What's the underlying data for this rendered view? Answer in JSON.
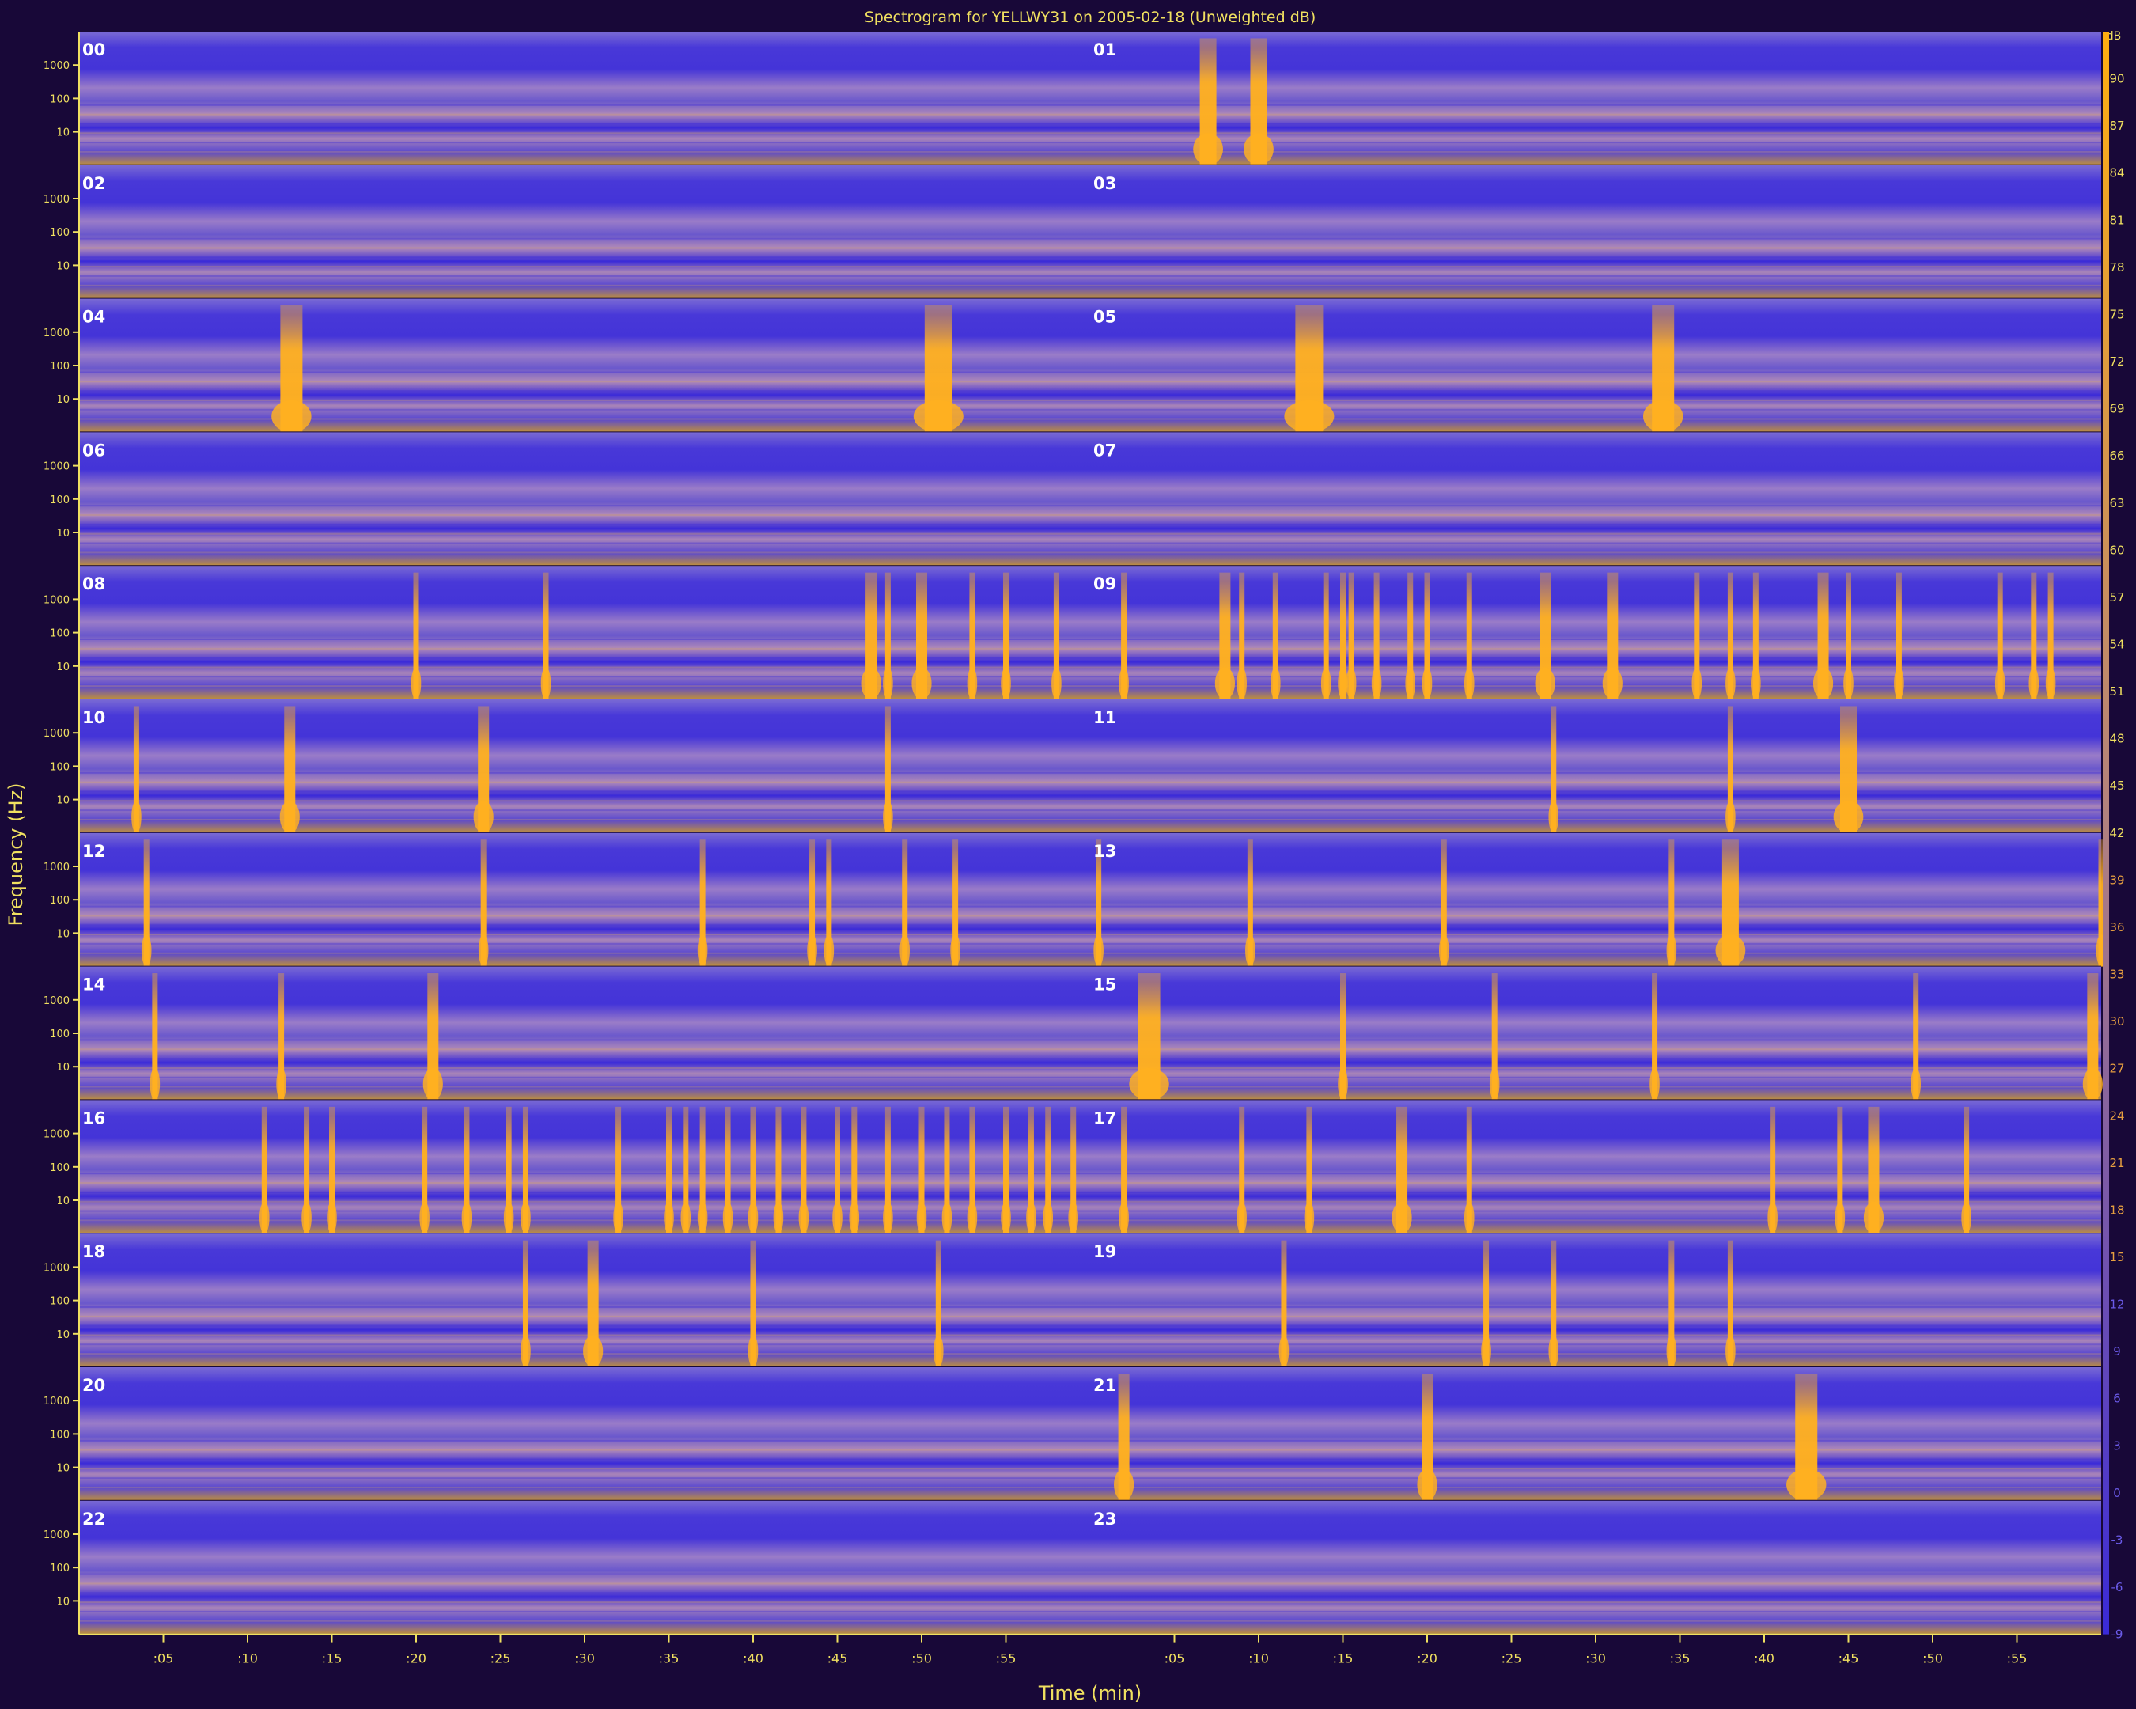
{
  "chart_data": {
    "type": "heatmap",
    "title": "Spectrogram for YELLWY31 on 2005-02-18 (Unweighted dB)",
    "xlabel": "Time (min)",
    "ylabel": "Frequency (Hz)",
    "colorbar_unit": "dB",
    "colormap": {
      "low": "#3a2ad8",
      "mid": "#8a6ad0",
      "high": "#ffae10"
    },
    "x_ticks": [
      ":05",
      ":10",
      ":15",
      ":20",
      ":25",
      ":30",
      ":35",
      ":40",
      ":45",
      ":50",
      ":55"
    ],
    "x_tick_minutes": [
      5,
      10,
      15,
      20,
      25,
      30,
      35,
      40,
      45,
      50,
      55
    ],
    "xlim": [
      0,
      60
    ],
    "y_ticks": [
      "1000",
      "100",
      "10"
    ],
    "y_tick_hz": [
      1000,
      100,
      10
    ],
    "y_scale": "log",
    "colorbar_ticks": [
      90,
      87,
      84,
      81,
      78,
      75,
      72,
      69,
      66,
      63,
      60,
      57,
      54,
      51,
      48,
      45,
      42,
      39,
      36,
      33,
      30,
      27,
      24,
      21,
      18,
      15,
      12,
      9,
      6,
      3,
      0,
      -3,
      -6,
      -9
    ],
    "colorbar_range": [
      -9,
      93
    ],
    "rows": [
      {
        "hours": [
          "00",
          "01"
        ],
        "events": [
          [
            0,
            70,
            3
          ],
          [
            50,
            70,
            6
          ],
          [
            0,
            67,
            3
          ],
          [
            65,
            67,
            3
          ]
        ]
      },
      {
        "hours": [
          "02",
          "03"
        ],
        "events": []
      },
      {
        "hours": [
          "04",
          "05"
        ],
        "events": [
          [
            0,
            51,
            5
          ],
          [
            0,
            12.6,
            4
          ],
          [
            1,
            13,
            5
          ],
          [
            1,
            34,
            4
          ]
        ]
      },
      {
        "hours": [
          "06",
          "07"
        ],
        "events": []
      },
      {
        "hours": [
          "08",
          "09"
        ],
        "events": [
          [
            0,
            20,
            1
          ],
          [
            0,
            27.7,
            1
          ],
          [
            0,
            47,
            2
          ],
          [
            0,
            48,
            1
          ],
          [
            0,
            50,
            2
          ],
          [
            0,
            53,
            1
          ],
          [
            0,
            55,
            1
          ],
          [
            0,
            58,
            1
          ],
          [
            1,
            2,
            1
          ],
          [
            1,
            8,
            2
          ],
          [
            1,
            9,
            1
          ],
          [
            1,
            11,
            1
          ],
          [
            1,
            14,
            1
          ],
          [
            1,
            15,
            1
          ],
          [
            1,
            15.5,
            1
          ],
          [
            1,
            17,
            1
          ],
          [
            1,
            19,
            1
          ],
          [
            1,
            20,
            1
          ],
          [
            1,
            22.5,
            1
          ],
          [
            1,
            27,
            2
          ],
          [
            1,
            31,
            2
          ],
          [
            1,
            36,
            1
          ],
          [
            1,
            38,
            1
          ],
          [
            1,
            39.5,
            1
          ],
          [
            1,
            43.5,
            2
          ],
          [
            1,
            45,
            1
          ],
          [
            1,
            48,
            1
          ],
          [
            1,
            54,
            1
          ],
          [
            1,
            56,
            1
          ],
          [
            1,
            57,
            1
          ]
        ]
      },
      {
        "hours": [
          "10",
          "11"
        ],
        "events": [
          [
            0,
            3.4,
            1
          ],
          [
            0,
            12.5,
            2
          ],
          [
            0,
            24,
            2
          ],
          [
            0,
            48,
            1
          ],
          [
            1,
            27.5,
            1
          ],
          [
            1,
            38,
            1
          ],
          [
            1,
            45,
            3
          ]
        ]
      },
      {
        "hours": [
          "12",
          "13"
        ],
        "events": [
          [
            0,
            4,
            1
          ],
          [
            0,
            24,
            1
          ],
          [
            0,
            37,
            1
          ],
          [
            0,
            43.5,
            1
          ],
          [
            0,
            44.5,
            1
          ],
          [
            0,
            49,
            1
          ],
          [
            0,
            52,
            1
          ],
          [
            1,
            0.5,
            1
          ],
          [
            1,
            9.5,
            1
          ],
          [
            1,
            21,
            1
          ],
          [
            1,
            34.5,
            1
          ],
          [
            1,
            38,
            3
          ],
          [
            1,
            60,
            1
          ]
        ]
      },
      {
        "hours": [
          "14",
          "15"
        ],
        "events": [
          [
            0,
            4.5,
            1
          ],
          [
            0,
            12,
            1
          ],
          [
            0,
            21,
            2
          ],
          [
            1,
            3.5,
            4
          ],
          [
            1,
            15,
            1
          ],
          [
            1,
            24,
            1
          ],
          [
            1,
            33.5,
            1
          ],
          [
            1,
            49,
            1
          ],
          [
            1,
            59.5,
            2
          ]
        ]
      },
      {
        "hours": [
          "16",
          "17"
        ],
        "events": [
          [
            0,
            11,
            1
          ],
          [
            0,
            13.5,
            1
          ],
          [
            0,
            15,
            1
          ],
          [
            0,
            20.5,
            1
          ],
          [
            0,
            23,
            1
          ],
          [
            0,
            25.5,
            1
          ],
          [
            0,
            26.5,
            1
          ],
          [
            0,
            32,
            1
          ],
          [
            0,
            35,
            1
          ],
          [
            0,
            36,
            1
          ],
          [
            0,
            37,
            1
          ],
          [
            0,
            38.5,
            1
          ],
          [
            0,
            40,
            1
          ],
          [
            0,
            41.5,
            1
          ],
          [
            0,
            43,
            1
          ],
          [
            0,
            45,
            1
          ],
          [
            0,
            46,
            1
          ],
          [
            0,
            48,
            1
          ],
          [
            0,
            50,
            1
          ],
          [
            0,
            51.5,
            1
          ],
          [
            0,
            53,
            1
          ],
          [
            0,
            55,
            1
          ],
          [
            0,
            56.5,
            1
          ],
          [
            0,
            57.5,
            1
          ],
          [
            0,
            59,
            1
          ],
          [
            1,
            2,
            1
          ],
          [
            1,
            9,
            1
          ],
          [
            1,
            13,
            1
          ],
          [
            1,
            18.5,
            2
          ],
          [
            1,
            22.5,
            1
          ],
          [
            1,
            40.5,
            1
          ],
          [
            1,
            44.5,
            1
          ],
          [
            1,
            46.5,
            2
          ],
          [
            1,
            52,
            1
          ]
        ]
      },
      {
        "hours": [
          "18",
          "19"
        ],
        "events": [
          [
            0,
            26.5,
            1
          ],
          [
            0,
            30.5,
            2
          ],
          [
            0,
            40,
            1
          ],
          [
            0,
            51,
            1
          ],
          [
            1,
            11.5,
            1
          ],
          [
            1,
            23.5,
            1
          ],
          [
            1,
            27.5,
            1
          ],
          [
            1,
            34.5,
            1
          ],
          [
            1,
            38,
            1
          ]
        ]
      },
      {
        "hours": [
          "20",
          "21"
        ],
        "events": [
          [
            1,
            42.5,
            4
          ],
          [
            1,
            2,
            2
          ],
          [
            1,
            20,
            2
          ]
        ]
      },
      {
        "hours": [
          "22",
          "23"
        ],
        "events": []
      }
    ]
  }
}
